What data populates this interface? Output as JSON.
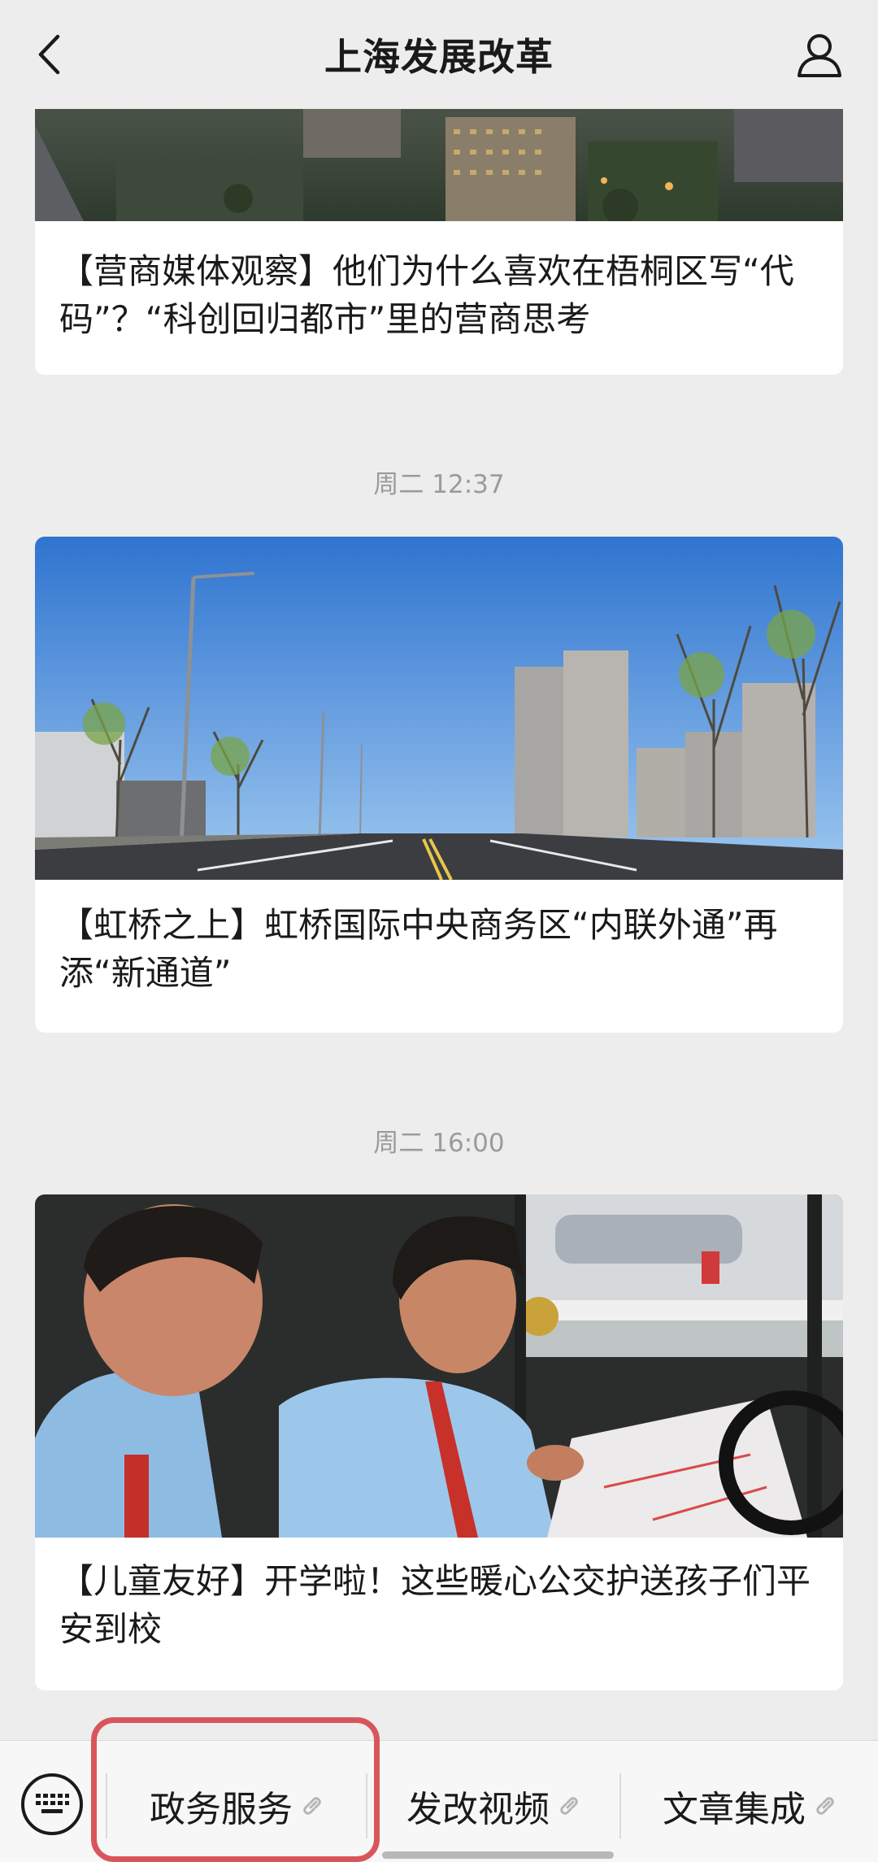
{
  "header": {
    "title": "上海发展改革",
    "back_icon": "chevron-left-icon",
    "profile_icon": "person-icon"
  },
  "feed": [
    {
      "caption": "【营商媒体观察】他们为什么喜欢在梧桐区写“代码”？“科创回归都市”里的营商思考",
      "image": "aerial city buildings at dusk"
    },
    {
      "timestamp": "周二 12:37",
      "caption": "【虹桥之上】虹桥国际中央商务区“内联外通”再添“新通道”",
      "image": "new road with trees and apartment buildings under blue sky"
    },
    {
      "timestamp": "周二 16:00",
      "caption": "【儿童友好】开学啦！这些暖心公交护送孩子们平安到校",
      "image": "bus drivers reading a route map"
    }
  ],
  "bottom_menu": {
    "keyboard_icon": "keyboard-icon",
    "items": [
      {
        "label": "政务服务",
        "icon": "link-icon"
      },
      {
        "label": "发改视频",
        "icon": "link-icon"
      },
      {
        "label": "文章集成",
        "icon": "link-icon"
      }
    ],
    "highlight_color": "#d9555c"
  }
}
